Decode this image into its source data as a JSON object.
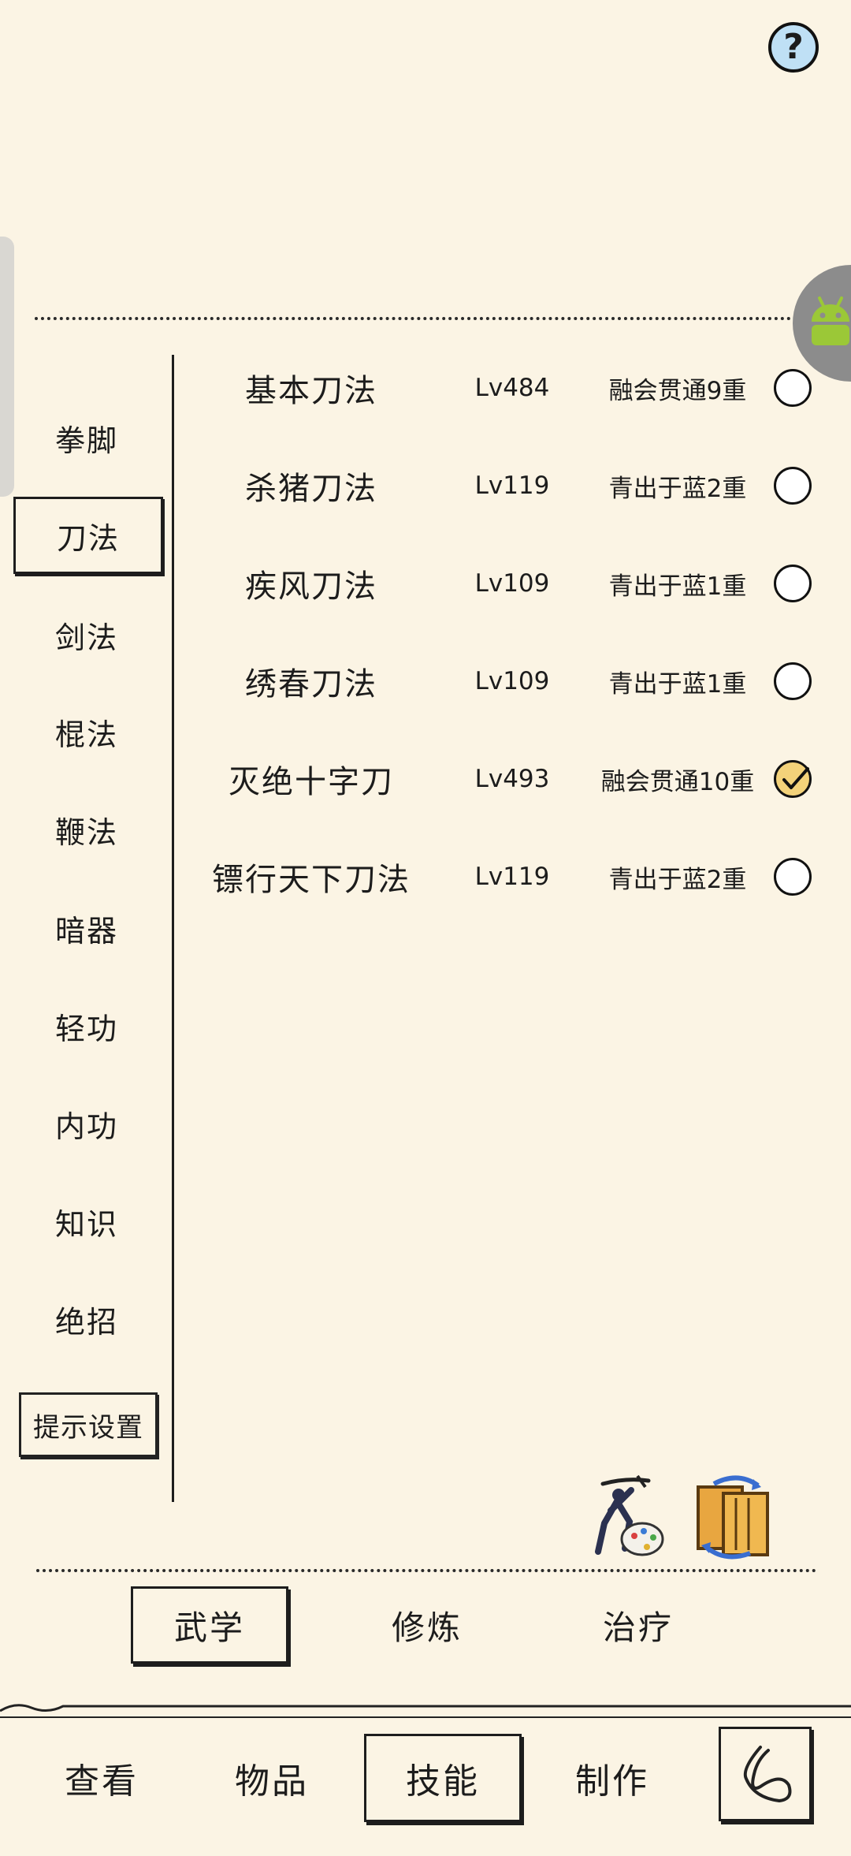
{
  "header": {
    "help_label": "?"
  },
  "categories": [
    {
      "label": "拳脚"
    },
    {
      "label": "刀法",
      "active": true
    },
    {
      "label": "剑法"
    },
    {
      "label": "棍法"
    },
    {
      "label": "鞭法"
    },
    {
      "label": "暗器"
    },
    {
      "label": "轻功"
    },
    {
      "label": "内功"
    },
    {
      "label": "知识"
    },
    {
      "label": "绝招"
    }
  ],
  "tip_settings_label": "提示设置",
  "skills": [
    {
      "name": "基本刀法",
      "level": "Lv484",
      "rank": "融会贯通9重",
      "checked": false
    },
    {
      "name": "杀猪刀法",
      "level": "Lv119",
      "rank": "青出于蓝2重",
      "checked": false
    },
    {
      "name": "疾风刀法",
      "level": "Lv109",
      "rank": "青出于蓝1重",
      "checked": false
    },
    {
      "name": "绣春刀法",
      "level": "Lv109",
      "rank": "青出于蓝1重",
      "checked": false
    },
    {
      "name": "灭绝十字刀",
      "level": "Lv493",
      "rank": "融会贯通10重",
      "checked": true
    },
    {
      "name": "镖行天下刀法",
      "level": "Lv119",
      "rank": "青出于蓝2重",
      "checked": false
    }
  ],
  "sub_tabs": [
    {
      "label": "武学",
      "active": true
    },
    {
      "label": "修炼"
    },
    {
      "label": "治疗"
    }
  ],
  "bottom_nav": [
    {
      "label": "查看"
    },
    {
      "label": "物品"
    },
    {
      "label": "技能",
      "active": true
    },
    {
      "label": "制作"
    }
  ],
  "icons": {
    "help": "question-icon",
    "android": "android-icon",
    "swordsman": "swordsman-palette-icon",
    "scroll_swap": "scroll-swap-icon",
    "back": "back-swirl-icon",
    "check": "check-icon"
  }
}
